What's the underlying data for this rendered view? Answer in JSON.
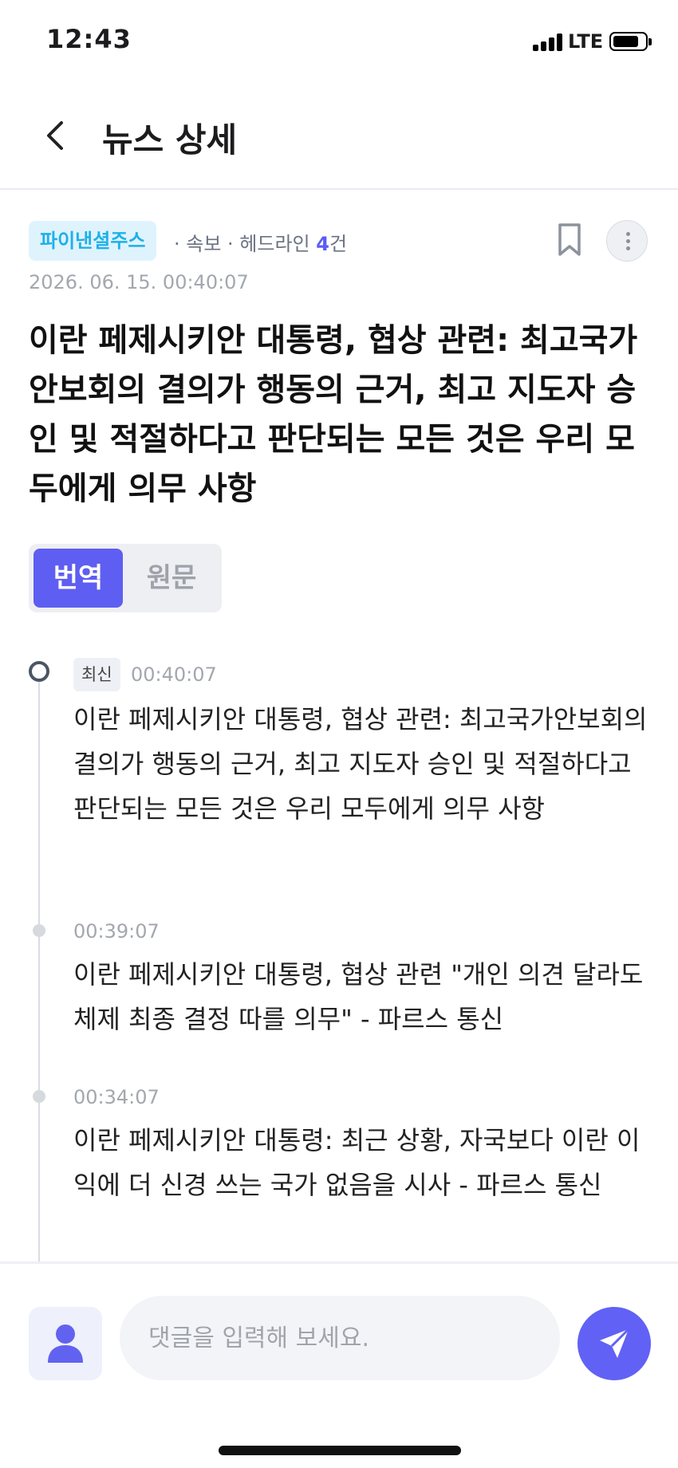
{
  "status_bar": {
    "time": "12:43",
    "network": "LTE",
    "battery_level": 0.7
  },
  "header": {
    "title": "뉴스 상세",
    "back_icon": "chevron-left-icon"
  },
  "article": {
    "source": "파이낸셜주스",
    "meta_prefix": "· 속보 · 헤드라인",
    "headline_count": "4",
    "meta_suffix": "건",
    "timestamp": "2026. 06. 15. 00:40:07",
    "headline": "이란 페제시키안 대통령, 협상 관련: 최고국가안보회의 결의가 행동의 근거, 최고 지도자 승인 및 적절하다고 판단되는 모든 것은 우리 모두에게 의무 사항"
  },
  "language_toggle": {
    "translated": "번역",
    "original": "원문",
    "selected": "번역"
  },
  "timeline": [
    {
      "badge": "최신",
      "time": "00:40:07",
      "text": "이란 페제시키안 대통령, 협상 관련: 최고국가안보회의 결의가 행동의 근거, 최고 지도자 승인 및 적절하다고 판단되는 모든 것은 우리 모두에게 의무 사항"
    },
    {
      "time": "00:39:07",
      "text": "이란 페제시키안 대통령, 협상 관련 \"개인 의견 달라도 체제 최종 결정 따를 의무\" - 파르스 통신"
    },
    {
      "time": "00:34:07",
      "text": "이란 페제시키안 대통령: 최근 상황, 자국보다 이란 이익에 더 신경 쓰는 국가 없음을 시사 - 파르스 통신"
    }
  ],
  "comment": {
    "placeholder": "댓글을 입력해 보세요.",
    "value": ""
  },
  "colors": {
    "accent": "#5e5ef2",
    "source_badge_bg": "#dff3fd",
    "source_badge_text": "#1eb0ea"
  }
}
